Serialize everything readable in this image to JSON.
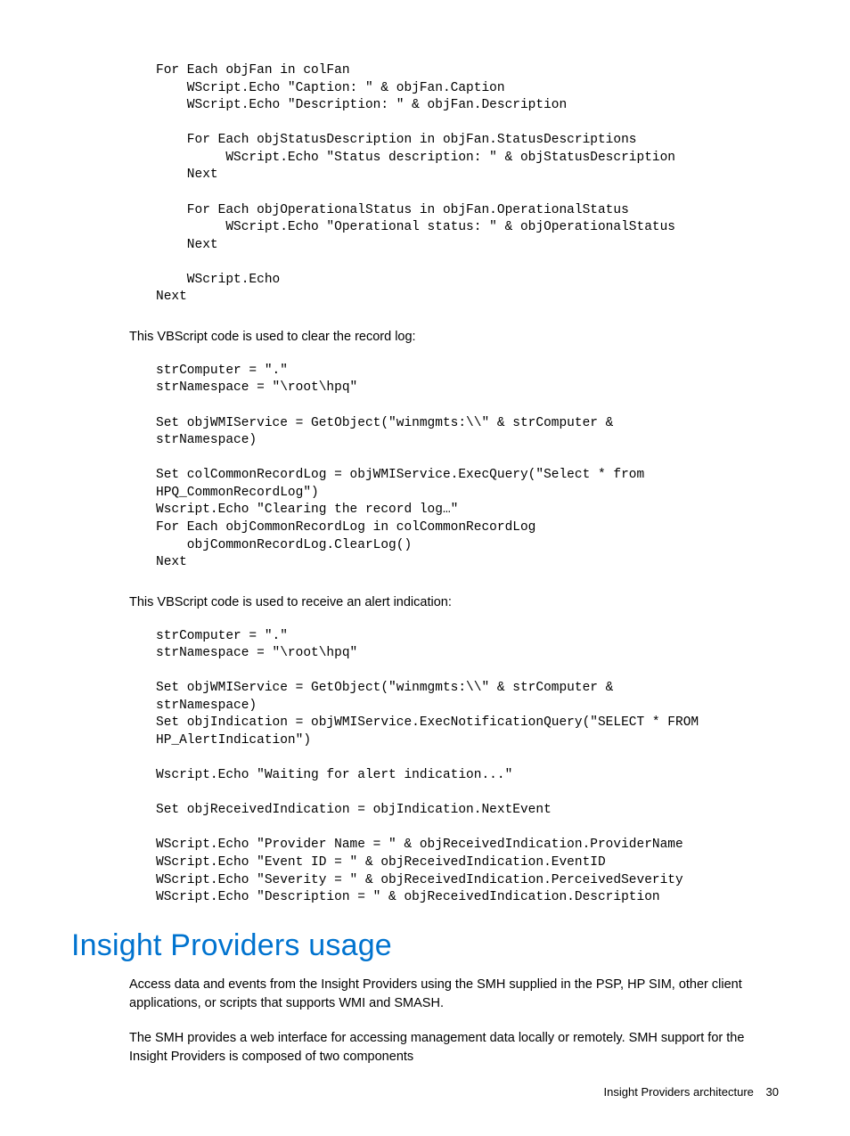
{
  "code1": "For Each objFan in colFan\n    WScript.Echo \"Caption: \" & objFan.Caption\n    WScript.Echo \"Description: \" & objFan.Description\n\n    For Each objStatusDescription in objFan.StatusDescriptions\n         WScript.Echo \"Status description: \" & objStatusDescription\n    Next\n\n    For Each objOperationalStatus in objFan.OperationalStatus\n         WScript.Echo \"Operational status: \" & objOperationalStatus\n    Next\n\n    WScript.Echo\nNext",
  "para1": "This VBScript code is used to clear the record log:",
  "code2": "strComputer = \".\"\nstrNamespace = \"\\root\\hpq\"\n\nSet objWMIService = GetObject(\"winmgmts:\\\\\" & strComputer &\nstrNamespace)\n\nSet colCommonRecordLog = objWMIService.ExecQuery(\"Select * from\nHPQ_CommonRecordLog\")\nWscript.Echo \"Clearing the record log…\"\nFor Each objCommonRecordLog in colCommonRecordLog\n    objCommonRecordLog.ClearLog()\nNext",
  "para2": "This VBScript code is used to receive an alert indication:",
  "code3": "strComputer = \".\"\nstrNamespace = \"\\root\\hpq\"\n\nSet objWMIService = GetObject(\"winmgmts:\\\\\" & strComputer &\nstrNamespace)\nSet objIndication = objWMIService.ExecNotificationQuery(\"SELECT * FROM\nHP_AlertIndication\")\n\nWscript.Echo \"Waiting for alert indication...\"\n\nSet objReceivedIndication = objIndication.NextEvent\n\nWScript.Echo \"Provider Name = \" & objReceivedIndication.ProviderName\nWScript.Echo \"Event ID = \" & objReceivedIndication.EventID\nWScript.Echo \"Severity = \" & objReceivedIndication.PerceivedSeverity\nWScript.Echo \"Description = \" & objReceivedIndication.Description",
  "heading": "Insight Providers usage",
  "para3": "Access data and events from the Insight Providers using the SMH supplied in the PSP, HP SIM, other client applications, or scripts that supports WMI and SMASH.",
  "para4": "The SMH provides a web interface for accessing management data locally or remotely. SMH support for the Insight Providers is composed of two components",
  "footer": {
    "title": "Insight Providers architecture",
    "page": "30"
  }
}
